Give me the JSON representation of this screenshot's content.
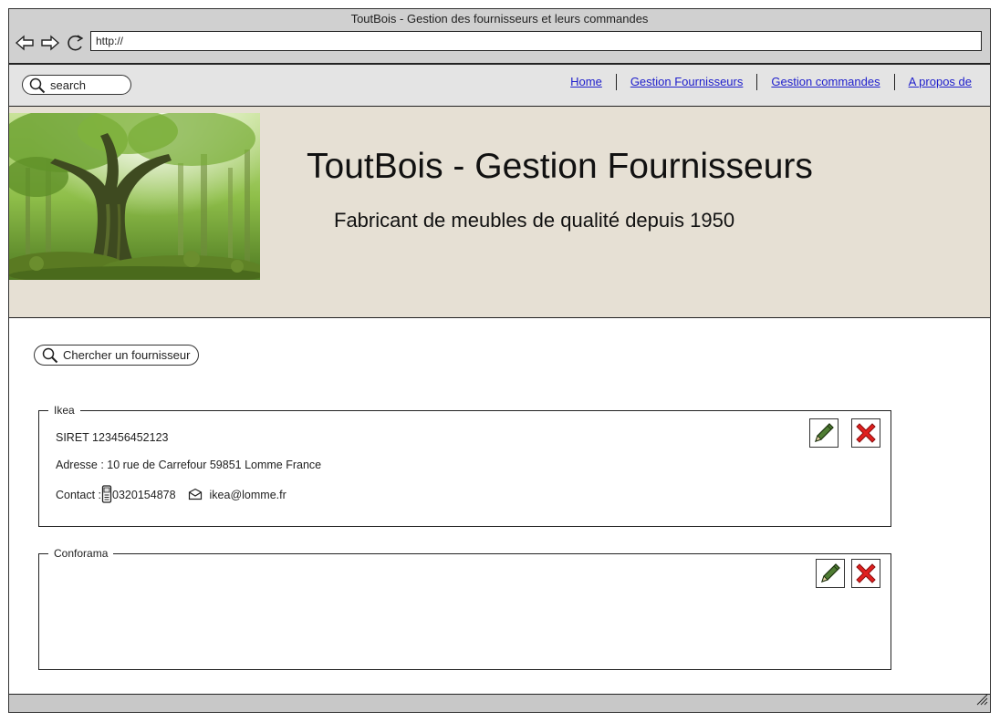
{
  "window": {
    "title": "ToutBois - Gestion des fournisseurs et leurs commandes",
    "url": "http://"
  },
  "topbar": {
    "search_placeholder": "search",
    "nav": [
      {
        "label": "Home"
      },
      {
        "label": "Gestion Fournisseurs"
      },
      {
        "label": "Gestion commandes"
      },
      {
        "label": "A propos de"
      }
    ]
  },
  "banner": {
    "title": "ToutBois - Gestion Fournisseurs",
    "subtitle": "Fabricant de meubles de qualité depuis 1950"
  },
  "supplier_search": {
    "label": "Chercher un fournisseur"
  },
  "suppliers": [
    {
      "name": "Ikea",
      "siret": "SIRET 123456452123",
      "address": "Adresse : 10 rue de Carrefour 59851 Lomme France",
      "contact_prefix": "Contact :",
      "phone": "0320154878",
      "email": "ikea@lomme.fr"
    },
    {
      "name": "Conforama"
    }
  ],
  "icons": {
    "edit": "pencil-icon",
    "delete": "red-x-icon",
    "phone": "mobile-phone-icon",
    "email": "envelope-icon"
  },
  "colors": {
    "link": "#2020cc",
    "banner_bg": "#e6e0d4",
    "delete_red": "#e0201f",
    "pencil_green": "#3f6b2a"
  }
}
